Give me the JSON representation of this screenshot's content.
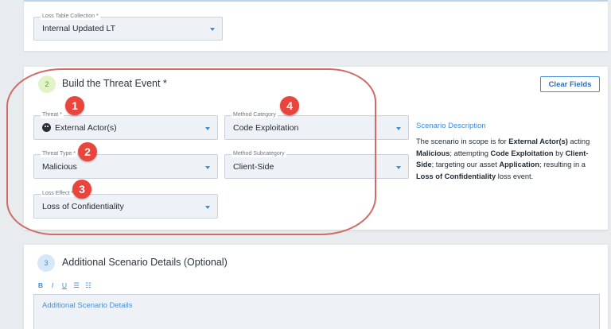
{
  "loss_table": {
    "label": "Loss Table Collection *",
    "value": "Internal Updated LT"
  },
  "section2": {
    "number": "2",
    "title": "Build the Threat Event *",
    "clear_label": "Clear Fields",
    "threat": {
      "label": "Threat *",
      "value": "External Actor(s)",
      "icon": "threat-actor-icon"
    },
    "threat_type": {
      "label": "Threat Type *",
      "value": "Malicious"
    },
    "loss_effect": {
      "label": "Loss Effect *",
      "value": "Loss of Confidentiality"
    },
    "method_category": {
      "label": "Method Category",
      "value": "Code Exploitation"
    },
    "method_subcategory": {
      "label": "Method Subcategory",
      "value": "Client-Side"
    },
    "description": {
      "title": "Scenario Description",
      "t1": "The scenario in scope is for ",
      "b1": "External Actor(s)",
      "t2": " acting ",
      "b2": "Malicious",
      "t3": "; attempting ",
      "b3": "Code Exploitation",
      "t4": " by ",
      "b4": "Client-Side",
      "t5": "; targeting our asset ",
      "b5": "Application",
      "t6": "; resulting in a ",
      "b6": "Loss of Confidentiality",
      "t7": " loss event."
    }
  },
  "annotations": [
    "1",
    "2",
    "3",
    "4"
  ],
  "section3": {
    "number": "3",
    "title": "Additional Scenario Details (Optional)",
    "toolbar": {
      "bold": "B",
      "italic": "I",
      "underline": "U",
      "bullets": "☰",
      "numbered": "☷"
    },
    "placeholder": "Additional Scenario Details"
  },
  "colors": {
    "accent": "#3d8ad6",
    "annotation": "#e9453d",
    "highlight": "#cf6c68"
  }
}
